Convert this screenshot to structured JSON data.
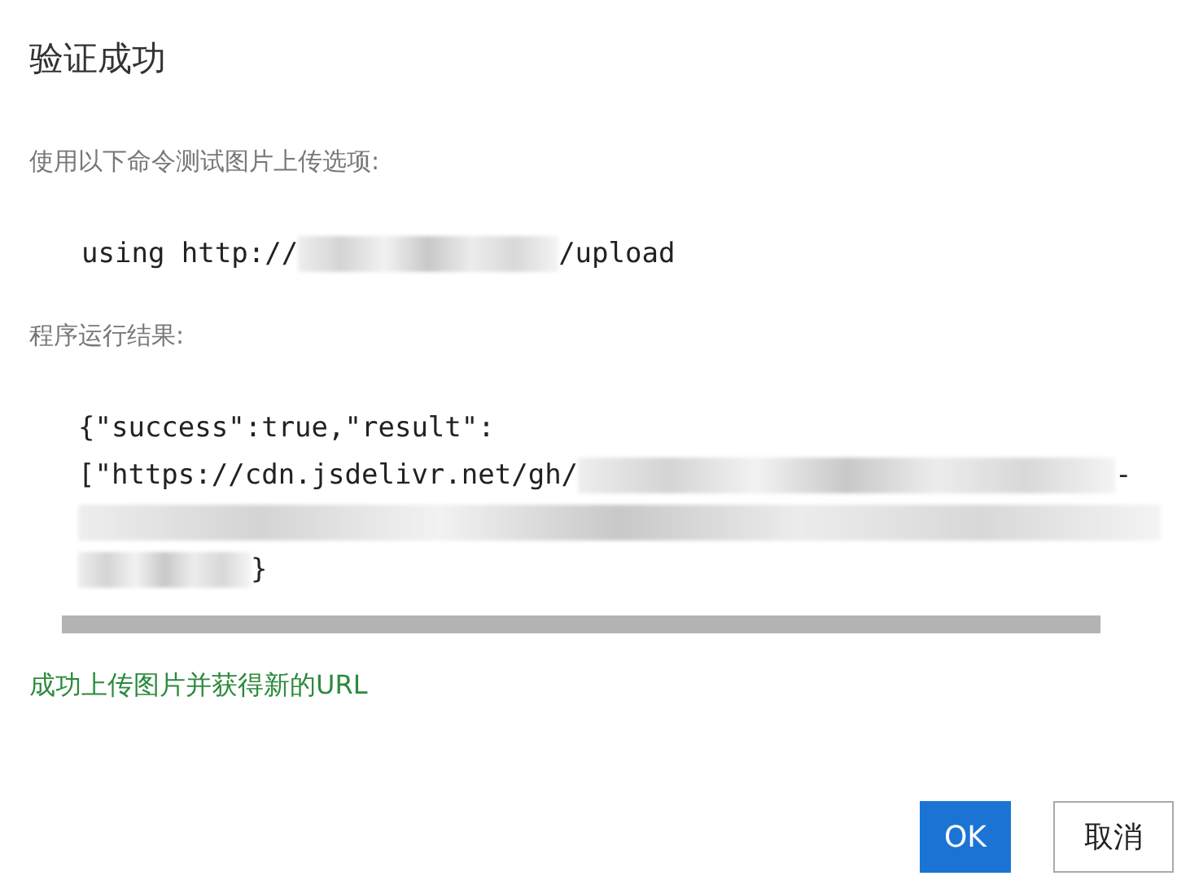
{
  "dialog": {
    "title": "验证成功"
  },
  "prompt": "使用以下命令测试图片上传选项:",
  "command": [
    {
      "kind": "text",
      "text": "using http://"
    },
    {
      "kind": "redacted"
    },
    {
      "kind": "text",
      "text": "/upload"
    }
  ],
  "result_label": "程序运行结果:",
  "result_lines": [
    [
      {
        "kind": "text",
        "text": "{\"success\":true,\"result\":"
      }
    ],
    [
      {
        "kind": "text",
        "text": "[\"https://cdn.jsdelivr.net/gh/"
      },
      {
        "kind": "redacted"
      },
      {
        "kind": "text",
        "text": "-"
      }
    ],
    [
      {
        "kind": "redacted"
      }
    ],
    [
      {
        "kind": "redacted"
      },
      {
        "kind": "text",
        "text": "}"
      }
    ]
  ],
  "success_message": "成功上传图片并获得新的URL",
  "buttons": [
    {
      "label": "OK",
      "kind": "primary"
    },
    {
      "label": "取消",
      "kind": "secondary"
    }
  ]
}
